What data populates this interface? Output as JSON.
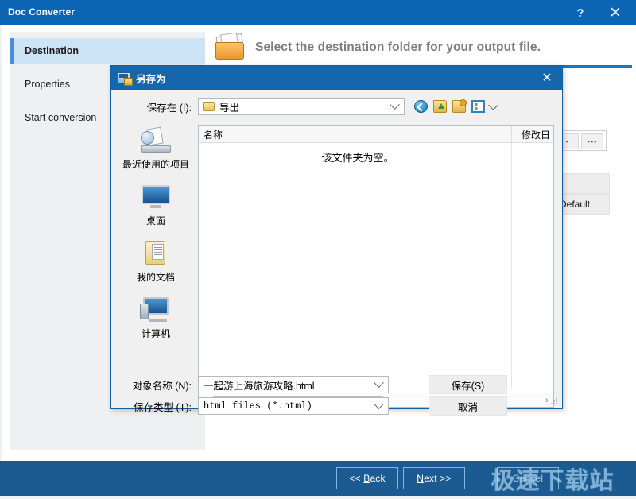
{
  "window": {
    "title": "Doc Converter",
    "help_icon": "?",
    "close_icon": "✕",
    "accent_color": "#0b64b4",
    "footer_color": "#1c5b91"
  },
  "sidebar": {
    "items": [
      {
        "label": "Destination",
        "active": true
      },
      {
        "label": "Properties",
        "active": false
      },
      {
        "label": "Start conversion",
        "active": false
      }
    ]
  },
  "content": {
    "header_text": "Select the destination folder for your output file.",
    "header_icon": "folder-icon",
    "dest_field_value": "",
    "dest_mini_a": "▪",
    "dest_mini_b": "▪▪▪",
    "right_button_1": "",
    "right_button_2": "Default"
  },
  "footer": {
    "back_label_pre": "<< ",
    "back_label_key": "B",
    "back_label_post": "ack",
    "next_label_key": "N",
    "next_label_post": "ext >>",
    "cancel_label": "Cancel",
    "watermark": "极速下载站"
  },
  "dialog": {
    "title": "另存为",
    "close_icon": "✕",
    "save_in_label": "保存在 (I):",
    "save_in_value": "导出",
    "toolbar_icons": [
      "back-icon",
      "up-folder-icon",
      "new-folder-icon",
      "view-mode-icon"
    ],
    "places": [
      {
        "label": "最近使用的项目",
        "icon": "recent-items-icon"
      },
      {
        "label": "桌面",
        "icon": "desktop-icon"
      },
      {
        "label": "我的文档",
        "icon": "my-documents-icon"
      },
      {
        "label": "计算机",
        "icon": "computer-icon"
      }
    ],
    "columns": {
      "name": "名称",
      "date": "修改日"
    },
    "empty_message": "该文件夹为空。",
    "scroll_left_icon": "‹",
    "scroll_right_icon": "›",
    "file_name_label": "对象名称 (N):",
    "file_name_value": "一起游上海旅游攻略.html",
    "file_type_label": "保存类型 (T):",
    "file_type_value": "html files (*.html)",
    "save_button": "保存(S)",
    "cancel_button": "取消"
  }
}
